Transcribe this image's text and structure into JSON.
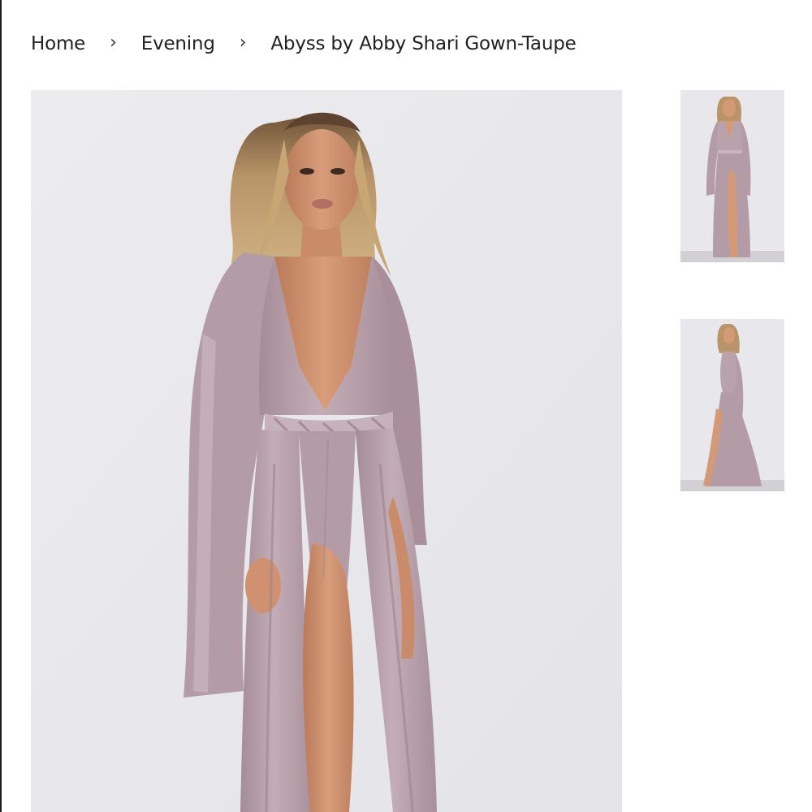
{
  "breadcrumb": {
    "home": "Home",
    "separator": "›",
    "category": "Evening",
    "current": "Abyss by Abby Shari Gown-Taupe"
  },
  "product": {
    "main_image_alt": "Abyss by Abby Shari Gown-Taupe",
    "thumbnails": [
      {
        "alt": "Abyss by Abby Shari Gown-Taupe front view"
      },
      {
        "alt": "Abyss by Abby Shari Gown-Taupe side view"
      }
    ]
  },
  "colors": {
    "backdrop": "#e9e8ec",
    "dress": "#b8a1ab",
    "dress_shadow": "#a58c97",
    "dress_highlight": "#cdb9c2",
    "skin": "#d69a78",
    "skin_shadow": "#b97a5a",
    "hair": "#c9a878",
    "hair_dark": "#6e5238"
  }
}
